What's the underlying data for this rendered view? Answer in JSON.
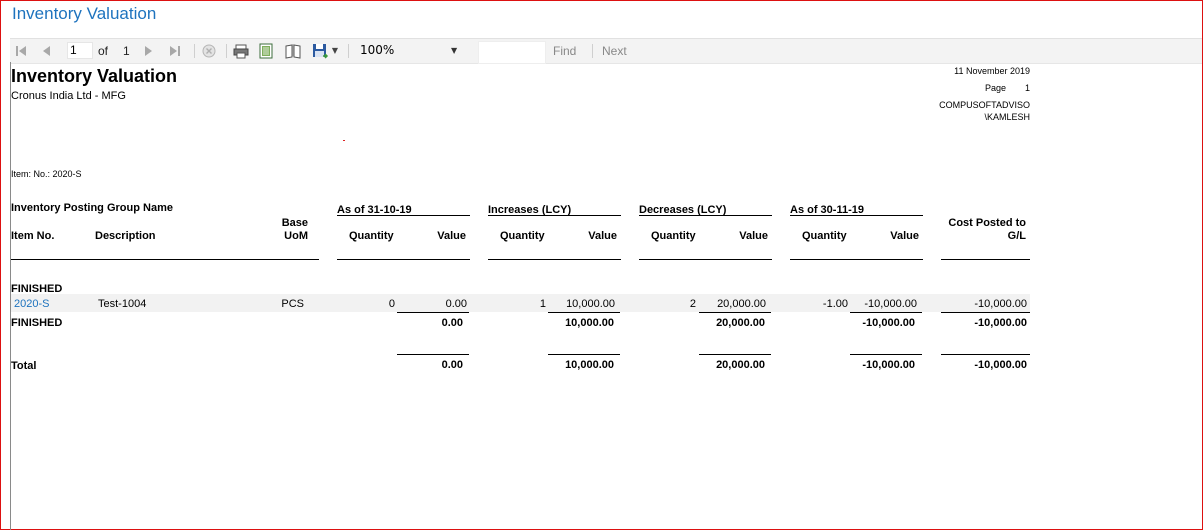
{
  "window": {
    "title": "Inventory Valuation"
  },
  "toolbar": {
    "page_current": "1",
    "page_of": "of",
    "page_total": "1",
    "zoom": "100%",
    "find_label": "Find",
    "next_label": "Next",
    "accent": "#1e73be"
  },
  "report": {
    "title": "Inventory Valuation",
    "company": "Cronus India Ltd - MFG",
    "date": "11 November 2019",
    "page_label": "Page",
    "page_number": "1",
    "user_line1": "COMPUSOFTADVISO",
    "user_line2": "\\KAMLESH",
    "filter": "Item: No.: 2020-S",
    "headers": {
      "posting_group": "Inventory Posting Group Name",
      "item_no": "Item No.",
      "description": "Description",
      "base_uom_1": "Base",
      "base_uom_2": "UoM",
      "as_of_start": "As of 31-10-19",
      "increases": "Increases (LCY)",
      "decreases": "Decreases (LCY)",
      "as_of_end": "As of 30-11-19",
      "quantity": "Quantity",
      "value": "Value",
      "cost_posted_1": "Cost Posted to",
      "cost_posted_2": "G/L"
    },
    "group": "FINISHED",
    "item": {
      "no": "2020-S",
      "description": "Test-1004",
      "uom": "PCS",
      "start_qty": "0",
      "start_value": "0.00",
      "inc_qty": "1",
      "inc_value": "10,000.00",
      "dec_qty": "2",
      "dec_value": "20,000.00",
      "end_qty": "-1.00",
      "end_value": "-10,000.00",
      "cost_posted": "-10,000.00"
    },
    "group_total": {
      "label": "FINISHED",
      "start_value": "0.00",
      "inc_value": "10,000.00",
      "dec_value": "20,000.00",
      "end_value": "-10,000.00",
      "cost_posted": "-10,000.00"
    },
    "grand_total": {
      "label": "Total",
      "start_value": "0.00",
      "inc_value": "10,000.00",
      "dec_value": "20,000.00",
      "end_value": "-10,000.00",
      "cost_posted": "-10,000.00"
    }
  }
}
